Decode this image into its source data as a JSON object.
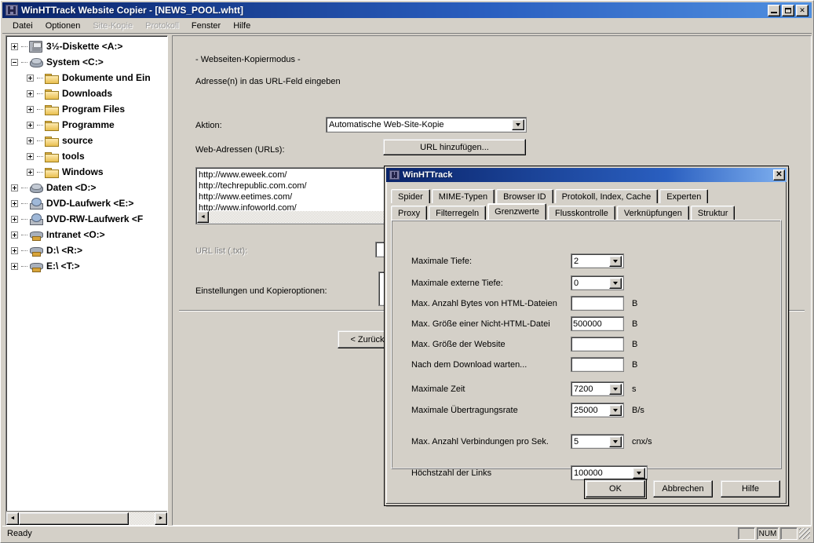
{
  "window": {
    "title": "WinHTTrack Website Copier - [NEWS_POOL.whtt]",
    "minimize_label": "",
    "maximize_label": "",
    "close_label": "✕"
  },
  "menu": {
    "items": [
      {
        "label": "Datei",
        "disabled": false
      },
      {
        "label": "Optionen",
        "disabled": false
      },
      {
        "label": "Site-Kopie",
        "disabled": true
      },
      {
        "label": "Protokoll",
        "disabled": true
      },
      {
        "label": "Fenster",
        "disabled": false
      },
      {
        "label": "Hilfe",
        "disabled": false
      }
    ]
  },
  "tree": {
    "nodes": [
      {
        "label": "3½-Diskette <A:>",
        "level": 1,
        "icon": "floppy-icon",
        "expander": "plus"
      },
      {
        "label": "System <C:>",
        "level": 1,
        "icon": "disk-icon",
        "expander": "minus"
      },
      {
        "label": "Dokumente und Ein",
        "level": 2,
        "icon": "folder-icon",
        "expander": "plus"
      },
      {
        "label": "Downloads",
        "level": 2,
        "icon": "folder-icon",
        "expander": "plus"
      },
      {
        "label": "Program Files",
        "level": 2,
        "icon": "folder-icon",
        "expander": "plus"
      },
      {
        "label": "Programme",
        "level": 2,
        "icon": "folder-icon",
        "expander": "plus"
      },
      {
        "label": "source",
        "level": 2,
        "icon": "folder-icon",
        "expander": "plus"
      },
      {
        "label": "tools",
        "level": 2,
        "icon": "folder-icon",
        "expander": "plus"
      },
      {
        "label": "Windows",
        "level": 2,
        "icon": "folder-icon",
        "expander": "plus"
      },
      {
        "label": "Daten <D:>",
        "level": 1,
        "icon": "disk-icon",
        "expander": "plus"
      },
      {
        "label": "DVD-Laufwerk <E:>",
        "level": 1,
        "icon": "cd-icon",
        "expander": "plus"
      },
      {
        "label": "DVD-RW-Laufwerk <F",
        "level": 1,
        "icon": "cd-icon",
        "expander": "plus"
      },
      {
        "label": "Intranet <O:>",
        "level": 1,
        "icon": "net-icon",
        "expander": "plus"
      },
      {
        "label": "D:\\ <R:>",
        "level": 1,
        "icon": "net-icon",
        "expander": "plus"
      },
      {
        "label": "E:\\ <T:>",
        "level": 1,
        "icon": "net-icon",
        "expander": "plus"
      }
    ],
    "scroll_left_arrow": "◄",
    "scroll_right_arrow": "►"
  },
  "main": {
    "mode_heading": "- Webseiten-Kopiermodus -",
    "instruction": "Adresse(n) in das URL-Feld eingeben",
    "action_label": "Aktion:",
    "action_value": "Automatische Web-Site-Kopie",
    "urls_label": "Web-Adressen (URLs):",
    "add_url_button": "URL hinzufügen...",
    "urls": [
      "http://www.eweek.com/",
      "http://techrepublic.com.com/",
      "http://www.eetimes.com/",
      "http://www.infoworld.com/"
    ],
    "url_list_label": "URL list (.txt):",
    "url_list_value": "",
    "settings_label": "Einstellungen und Kopieroptionen:",
    "back_button": "< Zurück",
    "scroll_left_arrow": "◄"
  },
  "dialog": {
    "title": "WinHTTrack",
    "close_label": "✕",
    "tabs_row1": [
      {
        "label": "Spider",
        "active": false
      },
      {
        "label": "MIME-Typen",
        "active": false
      },
      {
        "label": "Browser ID",
        "active": false
      },
      {
        "label": "Protokoll, Index, Cache",
        "active": false
      },
      {
        "label": "Experten",
        "active": false
      }
    ],
    "tabs_row2": [
      {
        "label": "Proxy",
        "active": false
      },
      {
        "label": "Filterregeln",
        "active": false
      },
      {
        "label": "Grenzwerte",
        "active": true
      },
      {
        "label": "Flusskontrolle",
        "active": false
      },
      {
        "label": "Verknüpfungen",
        "active": false
      },
      {
        "label": "Struktur",
        "active": false
      }
    ],
    "fields": [
      {
        "label": "Maximale Tiefe:",
        "value": "2",
        "unit": "",
        "control": "combo"
      },
      {
        "label": "Maximale externe Tiefe:",
        "value": "0",
        "unit": "",
        "control": "combo"
      },
      {
        "label": "Max. Anzahl Bytes von HTML-Dateien",
        "value": "",
        "unit": "B",
        "control": "text"
      },
      {
        "label": "Max. Größe einer Nicht-HTML-Datei",
        "value": "500000",
        "unit": "B",
        "control": "text"
      },
      {
        "label": "Max. Größe der Website",
        "value": "",
        "unit": "B",
        "control": "text"
      },
      {
        "label": "Nach dem Download warten...",
        "value": "",
        "unit": "B",
        "control": "text"
      },
      {
        "label": "Maximale Zeit",
        "value": "7200",
        "unit": "s",
        "control": "combo"
      },
      {
        "label": "Maximale Übertragungsrate",
        "value": "25000",
        "unit": "B/s",
        "control": "combo"
      },
      {
        "label": "Max. Anzahl Verbindungen pro Sek.",
        "value": "5",
        "unit": "cnx/s",
        "control": "combo"
      },
      {
        "label": "Höchstzahl der Links",
        "value": "100000",
        "unit": "",
        "control": "combo-wide"
      }
    ],
    "buttons": {
      "ok": "OK",
      "cancel": "Abbrechen",
      "help": "Hilfe"
    }
  },
  "statusbar": {
    "text": "Ready",
    "num_indicator": "NUM"
  },
  "colors": {
    "face": "#d4d0c8",
    "title_start": "#0a246a",
    "title_end": "#4f8fe0",
    "window": "#ffffff",
    "disabled_text": "#a0a0a0"
  }
}
